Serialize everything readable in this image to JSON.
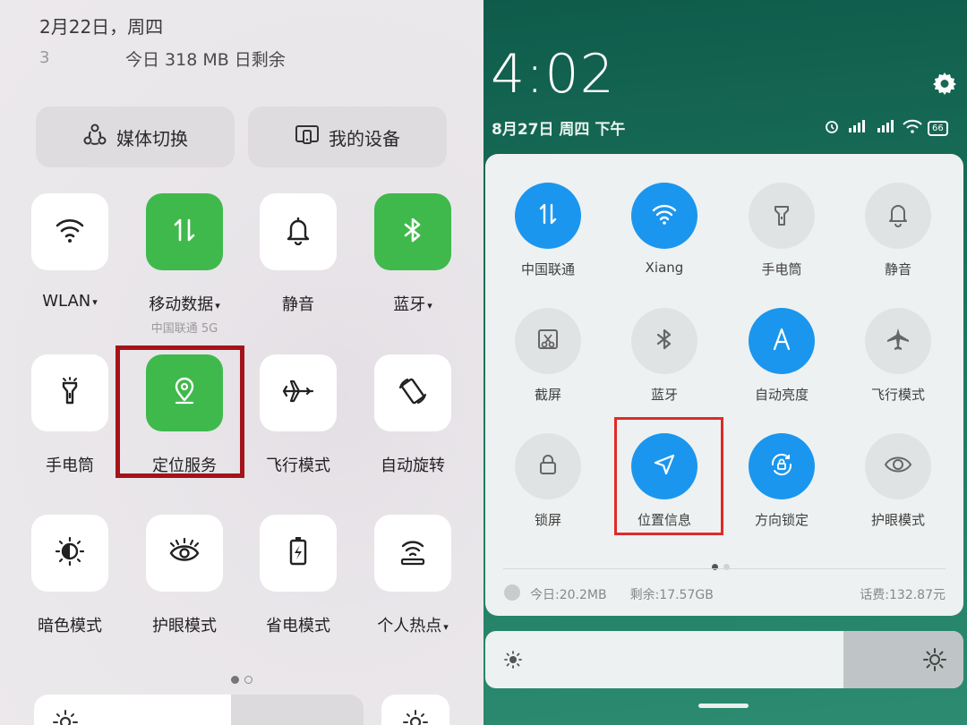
{
  "left": {
    "date": "2月22日，周四",
    "data_stub": "3",
    "data_usage": "今日 318 MB 日剩余",
    "pills": [
      {
        "label": "媒体切换",
        "icon": "media-switch-icon"
      },
      {
        "label": "我的设备",
        "icon": "my-device-icon"
      }
    ],
    "tiles": [
      {
        "label": "WLAN",
        "caret": "▾",
        "sub": "",
        "on": false,
        "icon": "wifi-icon"
      },
      {
        "label": "移动数据",
        "caret": "▾",
        "sub": "中国联通 5G",
        "on": true,
        "icon": "mobile-data-icon"
      },
      {
        "label": "静音",
        "caret": "",
        "sub": "",
        "on": false,
        "icon": "bell-icon"
      },
      {
        "label": "蓝牙",
        "caret": "▾",
        "sub": "",
        "on": true,
        "icon": "bluetooth-icon"
      },
      {
        "label": "手电筒",
        "caret": "",
        "sub": "",
        "on": false,
        "icon": "flashlight-icon"
      },
      {
        "label": "定位服务",
        "caret": "",
        "sub": "",
        "on": true,
        "icon": "location-pin-icon"
      },
      {
        "label": "飞行模式",
        "caret": "",
        "sub": "",
        "on": false,
        "icon": "airplane-icon"
      },
      {
        "label": "自动旋转",
        "caret": "",
        "sub": "",
        "on": false,
        "icon": "auto-rotate-icon"
      },
      {
        "label": "暗色模式",
        "caret": "",
        "sub": "",
        "on": false,
        "icon": "dark-mode-icon"
      },
      {
        "label": "护眼模式",
        "caret": "",
        "sub": "",
        "on": false,
        "icon": "eye-icon"
      },
      {
        "label": "省电模式",
        "caret": "",
        "sub": "",
        "on": false,
        "icon": "battery-saver-icon"
      },
      {
        "label": "个人热点",
        "caret": "▾",
        "sub": "",
        "on": false,
        "icon": "hotspot-icon"
      }
    ],
    "page_dots": {
      "count": 2,
      "active": 0
    }
  },
  "right": {
    "time": "4:02",
    "date": "8月27日 周四 下午",
    "battery": "66",
    "tiles": [
      {
        "label": "中国联通",
        "on": true,
        "icon": "mobile-data-icon"
      },
      {
        "label": "Xiang",
        "on": true,
        "icon": "wifi-icon"
      },
      {
        "label": "手电筒",
        "on": false,
        "icon": "flashlight-icon"
      },
      {
        "label": "静音",
        "on": false,
        "icon": "bell-icon"
      },
      {
        "label": "截屏",
        "on": false,
        "icon": "screenshot-icon"
      },
      {
        "label": "蓝牙",
        "on": false,
        "icon": "bluetooth-icon"
      },
      {
        "label": "自动亮度",
        "on": true,
        "icon": "auto-brightness-icon"
      },
      {
        "label": "飞行模式",
        "on": false,
        "icon": "airplane-icon"
      },
      {
        "label": "锁屏",
        "on": false,
        "icon": "lock-icon"
      },
      {
        "label": "位置信息",
        "on": true,
        "icon": "location-arrow-icon"
      },
      {
        "label": "方向锁定",
        "on": true,
        "icon": "rotation-lock-icon"
      },
      {
        "label": "护眼模式",
        "on": false,
        "icon": "eye-icon"
      }
    ],
    "usage": {
      "today": "今日:20.2MB",
      "remaining": "剩余:17.57GB",
      "balance": "话费:132.87元"
    },
    "page_dots": {
      "count": 2,
      "active": 0
    }
  },
  "colors": {
    "active_green": "#3fb94c",
    "active_blue": "#1b96ee",
    "highlight_red": "#a3141a"
  }
}
